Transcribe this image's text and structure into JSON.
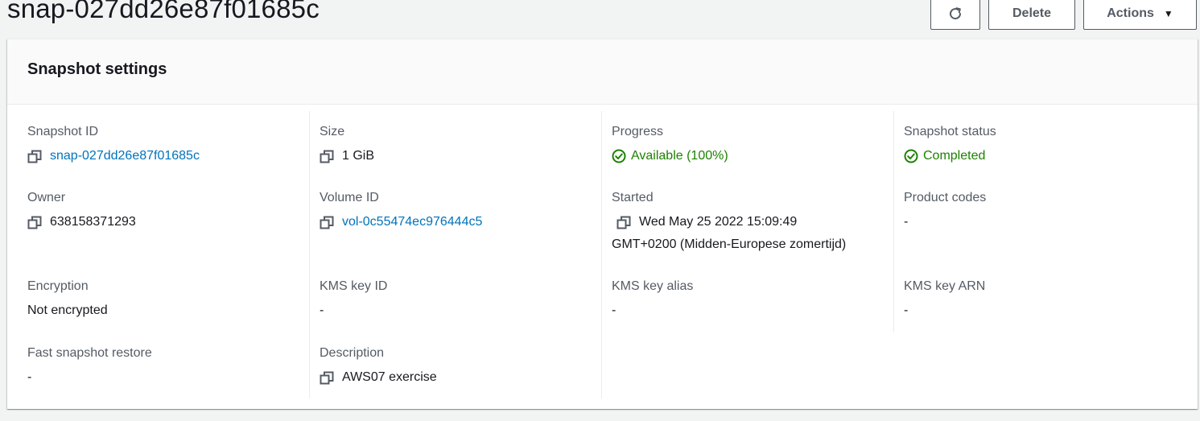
{
  "header": {
    "title": "snap-027dd26e87f01685c",
    "delete_label": "Delete",
    "actions_label": "Actions"
  },
  "panel": {
    "title": "Snapshot settings"
  },
  "fields": {
    "snapshot_id": {
      "label": "Snapshot ID",
      "value": "snap-027dd26e87f01685c"
    },
    "size": {
      "label": "Size",
      "value": "1 GiB"
    },
    "progress": {
      "label": "Progress",
      "value": "Available (100%)"
    },
    "snapshot_status": {
      "label": "Snapshot status",
      "value": "Completed"
    },
    "owner": {
      "label": "Owner",
      "value": "638158371293"
    },
    "volume_id": {
      "label": "Volume ID",
      "value": "vol-0c55474ec976444c5"
    },
    "started": {
      "label": "Started",
      "value_line1": "Wed May 25 2022 15:09:49",
      "value_line2": "GMT+0200 (Midden-Europese zomertijd)"
    },
    "product_codes": {
      "label": "Product codes",
      "value": "-"
    },
    "encryption": {
      "label": "Encryption",
      "value": "Not encrypted"
    },
    "kms_key_id": {
      "label": "KMS key ID",
      "value": "-"
    },
    "kms_key_alias": {
      "label": "KMS key alias",
      "value": "-"
    },
    "kms_key_arn": {
      "label": "KMS key ARN",
      "value": "-"
    },
    "fast_snapshot_restore": {
      "label": "Fast snapshot restore",
      "value": "-"
    },
    "description": {
      "label": "Description",
      "value": "AWS07 exercise"
    }
  },
  "colors": {
    "link": "#0073bb",
    "success": "#1d8102",
    "label": "#545b64",
    "text": "#16191f"
  }
}
